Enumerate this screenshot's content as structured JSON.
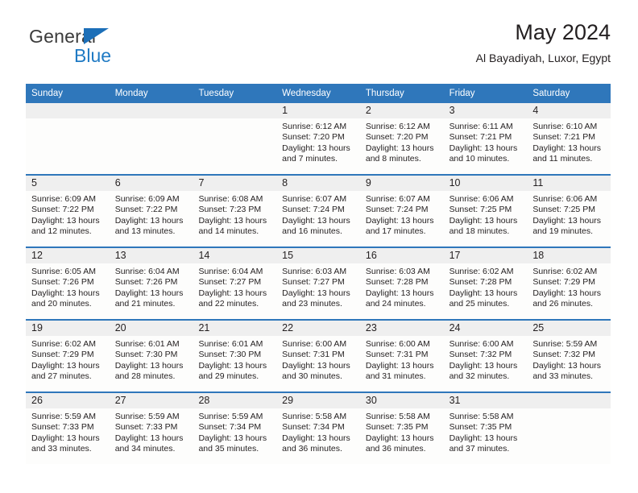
{
  "brand": {
    "name_top": "General",
    "name_bottom": "Blue",
    "triangle_color": "#1c6fb8",
    "text_color": "#3b3b3b",
    "blue_color": "#1f7ac4"
  },
  "header": {
    "title": "May 2024",
    "subtitle": "Al Bayadiyah, Luxor, Egypt"
  },
  "theme": {
    "header_band": "#2f77bb",
    "daynum_strip": "#efefef",
    "cell_bg": "#fdfdfc",
    "text": "#231f20"
  },
  "weekday_headers": [
    "Sunday",
    "Monday",
    "Tuesday",
    "Wednesday",
    "Thursday",
    "Friday",
    "Saturday"
  ],
  "weeks": [
    [
      {
        "day": "",
        "empty": true
      },
      {
        "day": "",
        "empty": true
      },
      {
        "day": "",
        "empty": true
      },
      {
        "day": "1",
        "sunrise": "Sunrise: 6:12 AM",
        "sunset": "Sunset: 7:20 PM",
        "daylight_1": "Daylight: 13 hours",
        "daylight_2": "and 7 minutes."
      },
      {
        "day": "2",
        "sunrise": "Sunrise: 6:12 AM",
        "sunset": "Sunset: 7:20 PM",
        "daylight_1": "Daylight: 13 hours",
        "daylight_2": "and 8 minutes."
      },
      {
        "day": "3",
        "sunrise": "Sunrise: 6:11 AM",
        "sunset": "Sunset: 7:21 PM",
        "daylight_1": "Daylight: 13 hours",
        "daylight_2": "and 10 minutes."
      },
      {
        "day": "4",
        "sunrise": "Sunrise: 6:10 AM",
        "sunset": "Sunset: 7:21 PM",
        "daylight_1": "Daylight: 13 hours",
        "daylight_2": "and 11 minutes."
      }
    ],
    [
      {
        "day": "5",
        "sunrise": "Sunrise: 6:09 AM",
        "sunset": "Sunset: 7:22 PM",
        "daylight_1": "Daylight: 13 hours",
        "daylight_2": "and 12 minutes."
      },
      {
        "day": "6",
        "sunrise": "Sunrise: 6:09 AM",
        "sunset": "Sunset: 7:22 PM",
        "daylight_1": "Daylight: 13 hours",
        "daylight_2": "and 13 minutes."
      },
      {
        "day": "7",
        "sunrise": "Sunrise: 6:08 AM",
        "sunset": "Sunset: 7:23 PM",
        "daylight_1": "Daylight: 13 hours",
        "daylight_2": "and 14 minutes."
      },
      {
        "day": "8",
        "sunrise": "Sunrise: 6:07 AM",
        "sunset": "Sunset: 7:24 PM",
        "daylight_1": "Daylight: 13 hours",
        "daylight_2": "and 16 minutes."
      },
      {
        "day": "9",
        "sunrise": "Sunrise: 6:07 AM",
        "sunset": "Sunset: 7:24 PM",
        "daylight_1": "Daylight: 13 hours",
        "daylight_2": "and 17 minutes."
      },
      {
        "day": "10",
        "sunrise": "Sunrise: 6:06 AM",
        "sunset": "Sunset: 7:25 PM",
        "daylight_1": "Daylight: 13 hours",
        "daylight_2": "and 18 minutes."
      },
      {
        "day": "11",
        "sunrise": "Sunrise: 6:06 AM",
        "sunset": "Sunset: 7:25 PM",
        "daylight_1": "Daylight: 13 hours",
        "daylight_2": "and 19 minutes."
      }
    ],
    [
      {
        "day": "12",
        "sunrise": "Sunrise: 6:05 AM",
        "sunset": "Sunset: 7:26 PM",
        "daylight_1": "Daylight: 13 hours",
        "daylight_2": "and 20 minutes."
      },
      {
        "day": "13",
        "sunrise": "Sunrise: 6:04 AM",
        "sunset": "Sunset: 7:26 PM",
        "daylight_1": "Daylight: 13 hours",
        "daylight_2": "and 21 minutes."
      },
      {
        "day": "14",
        "sunrise": "Sunrise: 6:04 AM",
        "sunset": "Sunset: 7:27 PM",
        "daylight_1": "Daylight: 13 hours",
        "daylight_2": "and 22 minutes."
      },
      {
        "day": "15",
        "sunrise": "Sunrise: 6:03 AM",
        "sunset": "Sunset: 7:27 PM",
        "daylight_1": "Daylight: 13 hours",
        "daylight_2": "and 23 minutes."
      },
      {
        "day": "16",
        "sunrise": "Sunrise: 6:03 AM",
        "sunset": "Sunset: 7:28 PM",
        "daylight_1": "Daylight: 13 hours",
        "daylight_2": "and 24 minutes."
      },
      {
        "day": "17",
        "sunrise": "Sunrise: 6:02 AM",
        "sunset": "Sunset: 7:28 PM",
        "daylight_1": "Daylight: 13 hours",
        "daylight_2": "and 25 minutes."
      },
      {
        "day": "18",
        "sunrise": "Sunrise: 6:02 AM",
        "sunset": "Sunset: 7:29 PM",
        "daylight_1": "Daylight: 13 hours",
        "daylight_2": "and 26 minutes."
      }
    ],
    [
      {
        "day": "19",
        "sunrise": "Sunrise: 6:02 AM",
        "sunset": "Sunset: 7:29 PM",
        "daylight_1": "Daylight: 13 hours",
        "daylight_2": "and 27 minutes."
      },
      {
        "day": "20",
        "sunrise": "Sunrise: 6:01 AM",
        "sunset": "Sunset: 7:30 PM",
        "daylight_1": "Daylight: 13 hours",
        "daylight_2": "and 28 minutes."
      },
      {
        "day": "21",
        "sunrise": "Sunrise: 6:01 AM",
        "sunset": "Sunset: 7:30 PM",
        "daylight_1": "Daylight: 13 hours",
        "daylight_2": "and 29 minutes."
      },
      {
        "day": "22",
        "sunrise": "Sunrise: 6:00 AM",
        "sunset": "Sunset: 7:31 PM",
        "daylight_1": "Daylight: 13 hours",
        "daylight_2": "and 30 minutes."
      },
      {
        "day": "23",
        "sunrise": "Sunrise: 6:00 AM",
        "sunset": "Sunset: 7:31 PM",
        "daylight_1": "Daylight: 13 hours",
        "daylight_2": "and 31 minutes."
      },
      {
        "day": "24",
        "sunrise": "Sunrise: 6:00 AM",
        "sunset": "Sunset: 7:32 PM",
        "daylight_1": "Daylight: 13 hours",
        "daylight_2": "and 32 minutes."
      },
      {
        "day": "25",
        "sunrise": "Sunrise: 5:59 AM",
        "sunset": "Sunset: 7:32 PM",
        "daylight_1": "Daylight: 13 hours",
        "daylight_2": "and 33 minutes."
      }
    ],
    [
      {
        "day": "26",
        "sunrise": "Sunrise: 5:59 AM",
        "sunset": "Sunset: 7:33 PM",
        "daylight_1": "Daylight: 13 hours",
        "daylight_2": "and 33 minutes."
      },
      {
        "day": "27",
        "sunrise": "Sunrise: 5:59 AM",
        "sunset": "Sunset: 7:33 PM",
        "daylight_1": "Daylight: 13 hours",
        "daylight_2": "and 34 minutes."
      },
      {
        "day": "28",
        "sunrise": "Sunrise: 5:59 AM",
        "sunset": "Sunset: 7:34 PM",
        "daylight_1": "Daylight: 13 hours",
        "daylight_2": "and 35 minutes."
      },
      {
        "day": "29",
        "sunrise": "Sunrise: 5:58 AM",
        "sunset": "Sunset: 7:34 PM",
        "daylight_1": "Daylight: 13 hours",
        "daylight_2": "and 36 minutes."
      },
      {
        "day": "30",
        "sunrise": "Sunrise: 5:58 AM",
        "sunset": "Sunset: 7:35 PM",
        "daylight_1": "Daylight: 13 hours",
        "daylight_2": "and 36 minutes."
      },
      {
        "day": "31",
        "sunrise": "Sunrise: 5:58 AM",
        "sunset": "Sunset: 7:35 PM",
        "daylight_1": "Daylight: 13 hours",
        "daylight_2": "and 37 minutes."
      },
      {
        "day": "",
        "empty": true
      }
    ]
  ]
}
